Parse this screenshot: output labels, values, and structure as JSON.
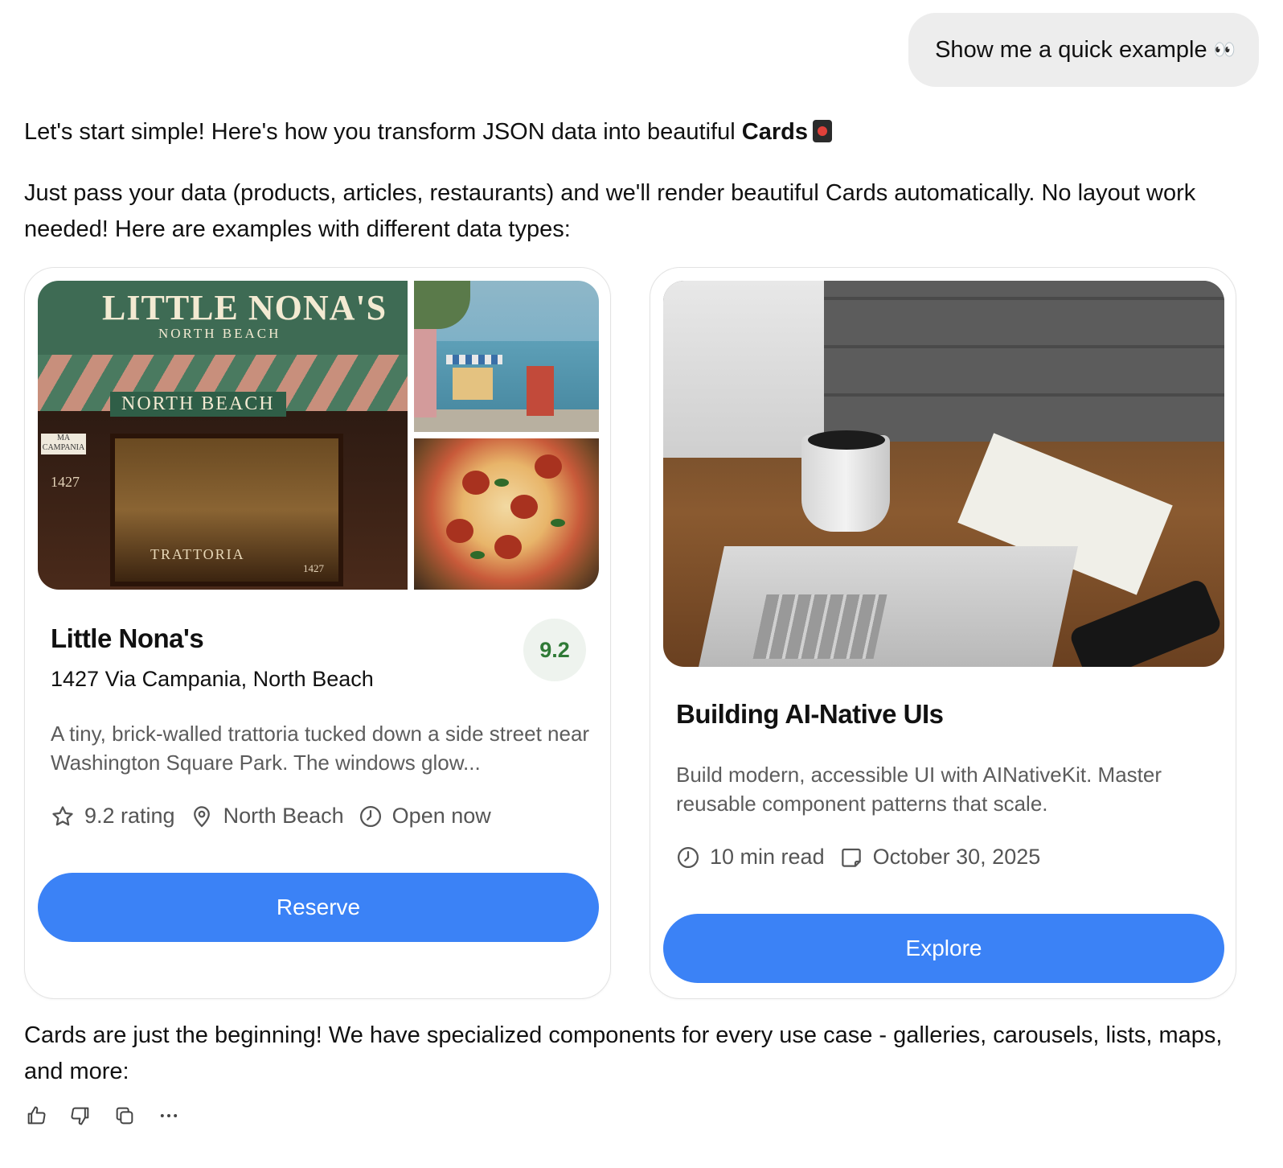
{
  "user_message": {
    "text": "Show me a quick example",
    "emoji": "👀"
  },
  "assistant": {
    "intro_before_bold": "Let's start simple! Here's how you transform JSON data into beautiful ",
    "intro_bold": "Cards",
    "intro_emoji": "cards-emoji",
    "description": "Just pass your data (products, articles, restaurants) and we'll render beautiful Cards automatically. No layout work needed! Here are examples with different data types:",
    "closing": "Cards are just the beginning! We have specialized components for every use case - galleries, carousels, lists, maps, and more:"
  },
  "restaurant_card": {
    "image_sign_title": "LITTLE NONA'S",
    "image_sign_sub": "NORTH BEACH",
    "image_awning": "NORTH BEACH",
    "image_window": "TRATTORIA",
    "image_plaque": "MA CAMPANIA",
    "image_number": "1427",
    "title": "Little Nona's",
    "address": "1427 Via Campania, North Beach",
    "rating_badge": "9.2",
    "description": "A tiny, brick-walled trattoria tucked down a side street near Washington Square Park. The windows glow...",
    "meta": [
      {
        "icon": "star-icon",
        "text": "9.2 rating"
      },
      {
        "icon": "location-pin-icon",
        "text": "North Beach"
      },
      {
        "icon": "clock-icon",
        "text": "Open now"
      }
    ],
    "button_label": "Reserve"
  },
  "article_card": {
    "title": "Building AI-Native UIs",
    "description": "Build modern, accessible UI with AINativeKit. Master reusable component patterns that scale.",
    "meta": [
      {
        "icon": "clock-icon",
        "text": "10 min read"
      },
      {
        "icon": "calendar-icon",
        "text": "October 30, 2025"
      }
    ],
    "button_label": "Explore"
  },
  "actions": [
    {
      "icon": "thumbs-up-icon"
    },
    {
      "icon": "thumbs-down-icon"
    },
    {
      "icon": "copy-icon"
    },
    {
      "icon": "more-icon"
    }
  ],
  "colors": {
    "accent": "#3b82f6",
    "rating_green": "#2f7a36",
    "bubble_bg": "#ededed"
  }
}
